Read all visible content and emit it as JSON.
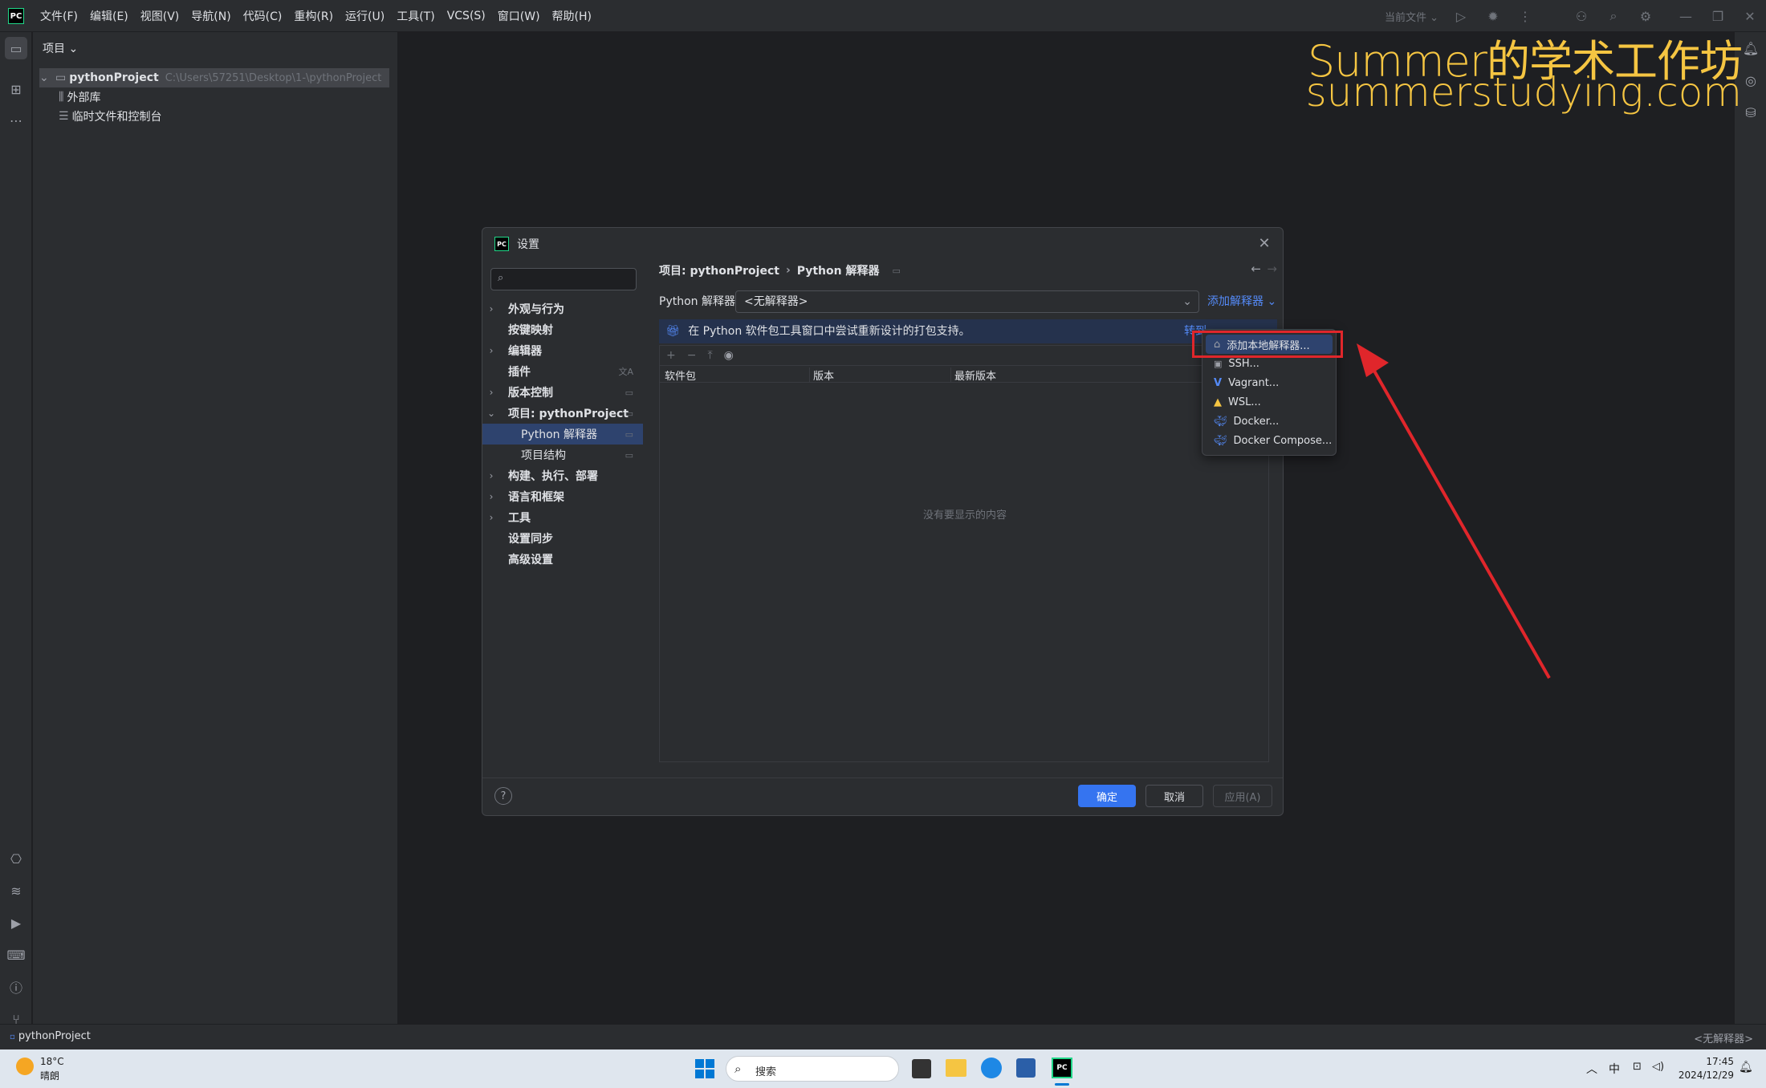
{
  "titlebar": {
    "logo": "PC",
    "menu": [
      "文件(F)",
      "编辑(E)",
      "视图(V)",
      "导航(N)",
      "代码(C)",
      "重构(R)",
      "运行(U)",
      "工具(T)",
      "VCS(S)",
      "窗口(W)",
      "帮助(H)"
    ],
    "run_config": "当前文件"
  },
  "project_panel": {
    "header": "项目",
    "root_name": "pythonProject",
    "root_path": "C:\\Users\\57251\\Desktop\\1-\\pythonProject",
    "items": [
      "外部库",
      "临时文件和控制台"
    ]
  },
  "watermark": {
    "line1": "Summer的学术工作坊",
    "line2": "summerstudying.com"
  },
  "dialog": {
    "title": "设置",
    "nav": [
      {
        "label": "外观与行为",
        "expand": true
      },
      {
        "label": "按键映射",
        "expand": false
      },
      {
        "label": "编辑器",
        "expand": true
      },
      {
        "label": "插件",
        "expand": false
      },
      {
        "label": "版本控制",
        "expand": true
      },
      {
        "label": "项目: pythonProject",
        "expand": true
      },
      {
        "label": "Python 解释器",
        "expand": false
      },
      {
        "label": "项目结构",
        "expand": false
      },
      {
        "label": "构建、执行、部署",
        "expand": true
      },
      {
        "label": "语言和框架",
        "expand": true
      },
      {
        "label": "工具",
        "expand": true
      },
      {
        "label": "设置同步",
        "expand": false
      },
      {
        "label": "高级设置",
        "expand": false
      }
    ],
    "breadcrumb_project": "项目: pythonProject",
    "breadcrumb_sep": "›",
    "breadcrumb_page": "Python 解释器",
    "interpreter_label": "Python 解释器:",
    "interpreter_value": "<无解释器>",
    "add_interpreter": "添加解释器",
    "banner_text": "在 Python 软件包工具窗口中尝试重新设计的打包支持。",
    "banner_link": "转到",
    "columns": [
      "软件包",
      "版本",
      "最新版本"
    ],
    "empty_text": "没有要显示的内容",
    "ok": "确定",
    "cancel": "取消",
    "apply": "应用(A)",
    "help": "?"
  },
  "popup": {
    "items": [
      {
        "label": "添加本地解释器...",
        "icon": "home-icon"
      },
      {
        "label": "SSH...",
        "icon": "ssh-icon"
      },
      {
        "label": "Vagrant...",
        "icon": "vagrant-icon"
      },
      {
        "label": "WSL...",
        "icon": "wsl-icon"
      },
      {
        "label": "Docker...",
        "icon": "docker-icon"
      },
      {
        "label": "Docker Compose...",
        "icon": "docker-compose-icon"
      }
    ]
  },
  "statusbar": {
    "project": "pythonProject",
    "interpreter": "<无解释器>"
  },
  "taskbar": {
    "weather_temp": "18°C",
    "weather_desc": "晴朗",
    "search": "搜索",
    "ime": "中",
    "time": "17:45",
    "date": "2024/12/29"
  },
  "colors": {
    "accent": "#3574f0",
    "annotation_red": "#e0262b",
    "watermark": "#f5c542"
  }
}
